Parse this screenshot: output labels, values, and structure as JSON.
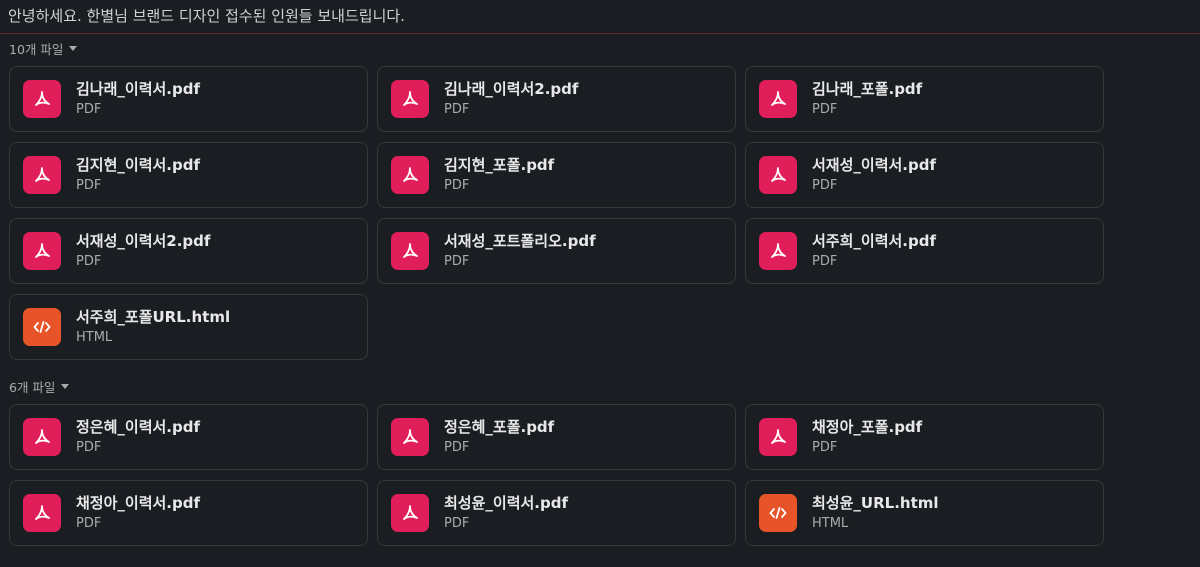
{
  "message": {
    "text": "안녕하세요. 한별님 브랜드 디자인 접수된 인원들 보내드립니다."
  },
  "colors": {
    "pdf_icon": "#e01e5a",
    "html_icon": "#e8542a"
  },
  "groups": [
    {
      "header": "10개 파일",
      "files": [
        {
          "name": "김나래_이력서.pdf",
          "type": "PDF",
          "icon": "pdf-icon"
        },
        {
          "name": "김나래_이력서2.pdf",
          "type": "PDF",
          "icon": "pdf-icon"
        },
        {
          "name": "김나래_포폴.pdf",
          "type": "PDF",
          "icon": "pdf-icon"
        },
        {
          "name": "김지현_이력서.pdf",
          "type": "PDF",
          "icon": "pdf-icon"
        },
        {
          "name": "김지현_포폴.pdf",
          "type": "PDF",
          "icon": "pdf-icon"
        },
        {
          "name": "서재성_이력서.pdf",
          "type": "PDF",
          "icon": "pdf-icon"
        },
        {
          "name": "서재성_이력서2.pdf",
          "type": "PDF",
          "icon": "pdf-icon"
        },
        {
          "name": "서재성_포트폴리오.pdf",
          "type": "PDF",
          "icon": "pdf-icon"
        },
        {
          "name": "서주희_이력서.pdf",
          "type": "PDF",
          "icon": "pdf-icon"
        },
        {
          "name": "서주희_포폴URL.html",
          "type": "HTML",
          "icon": "html-code-icon"
        }
      ]
    },
    {
      "header": "6개 파일",
      "files": [
        {
          "name": "정은혜_이력서.pdf",
          "type": "PDF",
          "icon": "pdf-icon"
        },
        {
          "name": "정은혜_포폴.pdf",
          "type": "PDF",
          "icon": "pdf-icon"
        },
        {
          "name": "채정아_포폴.pdf",
          "type": "PDF",
          "icon": "pdf-icon"
        },
        {
          "name": "채정아_이력서.pdf",
          "type": "PDF",
          "icon": "pdf-icon"
        },
        {
          "name": "최성윤_이력서.pdf",
          "type": "PDF",
          "icon": "pdf-icon"
        },
        {
          "name": "최성윤_URL.html",
          "type": "HTML",
          "icon": "html-code-icon"
        }
      ]
    }
  ]
}
